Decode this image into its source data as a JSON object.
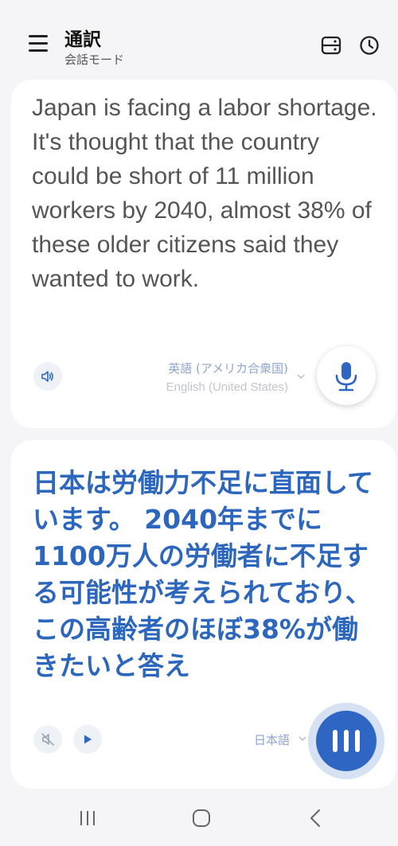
{
  "header": {
    "title": "通訳",
    "subtitle": "会話モード",
    "icons": [
      "menu-icon",
      "display-mode-icon",
      "history-icon"
    ]
  },
  "source": {
    "text": "Japan is facing a labor shortage. It's thought that the country could be short of 11 million workers by 2040, almost 38% of these older citizens said they wanted to work.",
    "language_native": "英語 (アメリカ合衆国)",
    "language_english": "English (United States)"
  },
  "target": {
    "text": "日本は労働力不足に直面しています。 2040年までに1100万人の労働者に不足する可能性が考えられており、この高齢者のほぼ38%が働きたいと答え",
    "language": "日本語"
  },
  "colors": {
    "accent": "#2f66c3",
    "translation_text": "#2c66bd",
    "background": "#f5f5f7"
  }
}
